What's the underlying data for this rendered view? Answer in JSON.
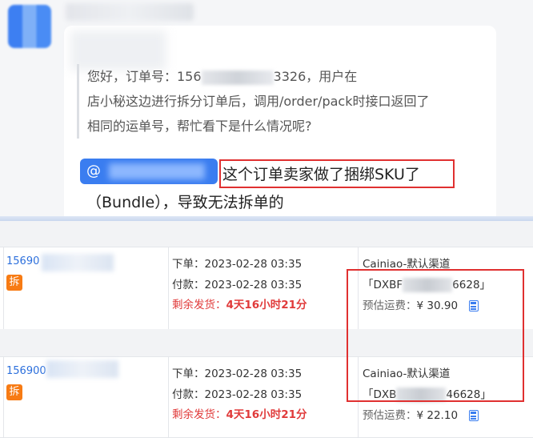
{
  "chat": {
    "quote_line1": "您好，订单号：156",
    "quote_line1_end": "3326，用户在",
    "quote_line2": "店小秘这边进行拆分订单后，调用/order/pack时接口返回了",
    "quote_line3": "相同的运单号，帮忙看下是什么情况呢?",
    "mention_prefix": "@",
    "reply_line1": "这个订单卖家做了捆绑SKU了",
    "reply_line2": "（Bundle），导致无法拆单的"
  },
  "orders": [
    {
      "id_prefix": "15690",
      "split_badge": "拆",
      "order_label": "下单：",
      "order_time": "2023-02-28 03:35",
      "pay_label": "付款：",
      "pay_time": "2023-02-28 03:35",
      "remain_label": "剩余发货：",
      "remain_days": "4天",
      "remain_hours": "16小时",
      "remain_mins": "21分",
      "carrier": "Cainiao-默认渠道",
      "tracking_open": "「DXBF",
      "tracking_end": "6628」",
      "fee_label": "预估运费：",
      "fee": "¥ 30.90",
      "calc_icon": "calculator-icon"
    },
    {
      "id_prefix": "156900",
      "split_badge": "拆",
      "order_label": "下单：",
      "order_time": "2023-02-28 03:35",
      "pay_label": "付款：",
      "pay_time": "2023-02-28 03:35",
      "remain_label": "剩余发货：",
      "remain_days": "4天",
      "remain_hours": "16小时",
      "remain_mins": "21分",
      "carrier": "Cainiao-默认渠道",
      "tracking_open": "「DXB",
      "tracking_end": "46628」",
      "fee_label": "预估运费：",
      "fee": "¥ 22.10",
      "calc_icon": "calculator-icon"
    }
  ],
  "colors": {
    "mention_bg": "#3a7df0",
    "highlight_border": "#e03030",
    "badge_orange": "#f77b14",
    "remain_red": "#e03a3a",
    "order_link": "#2c6fdc"
  }
}
